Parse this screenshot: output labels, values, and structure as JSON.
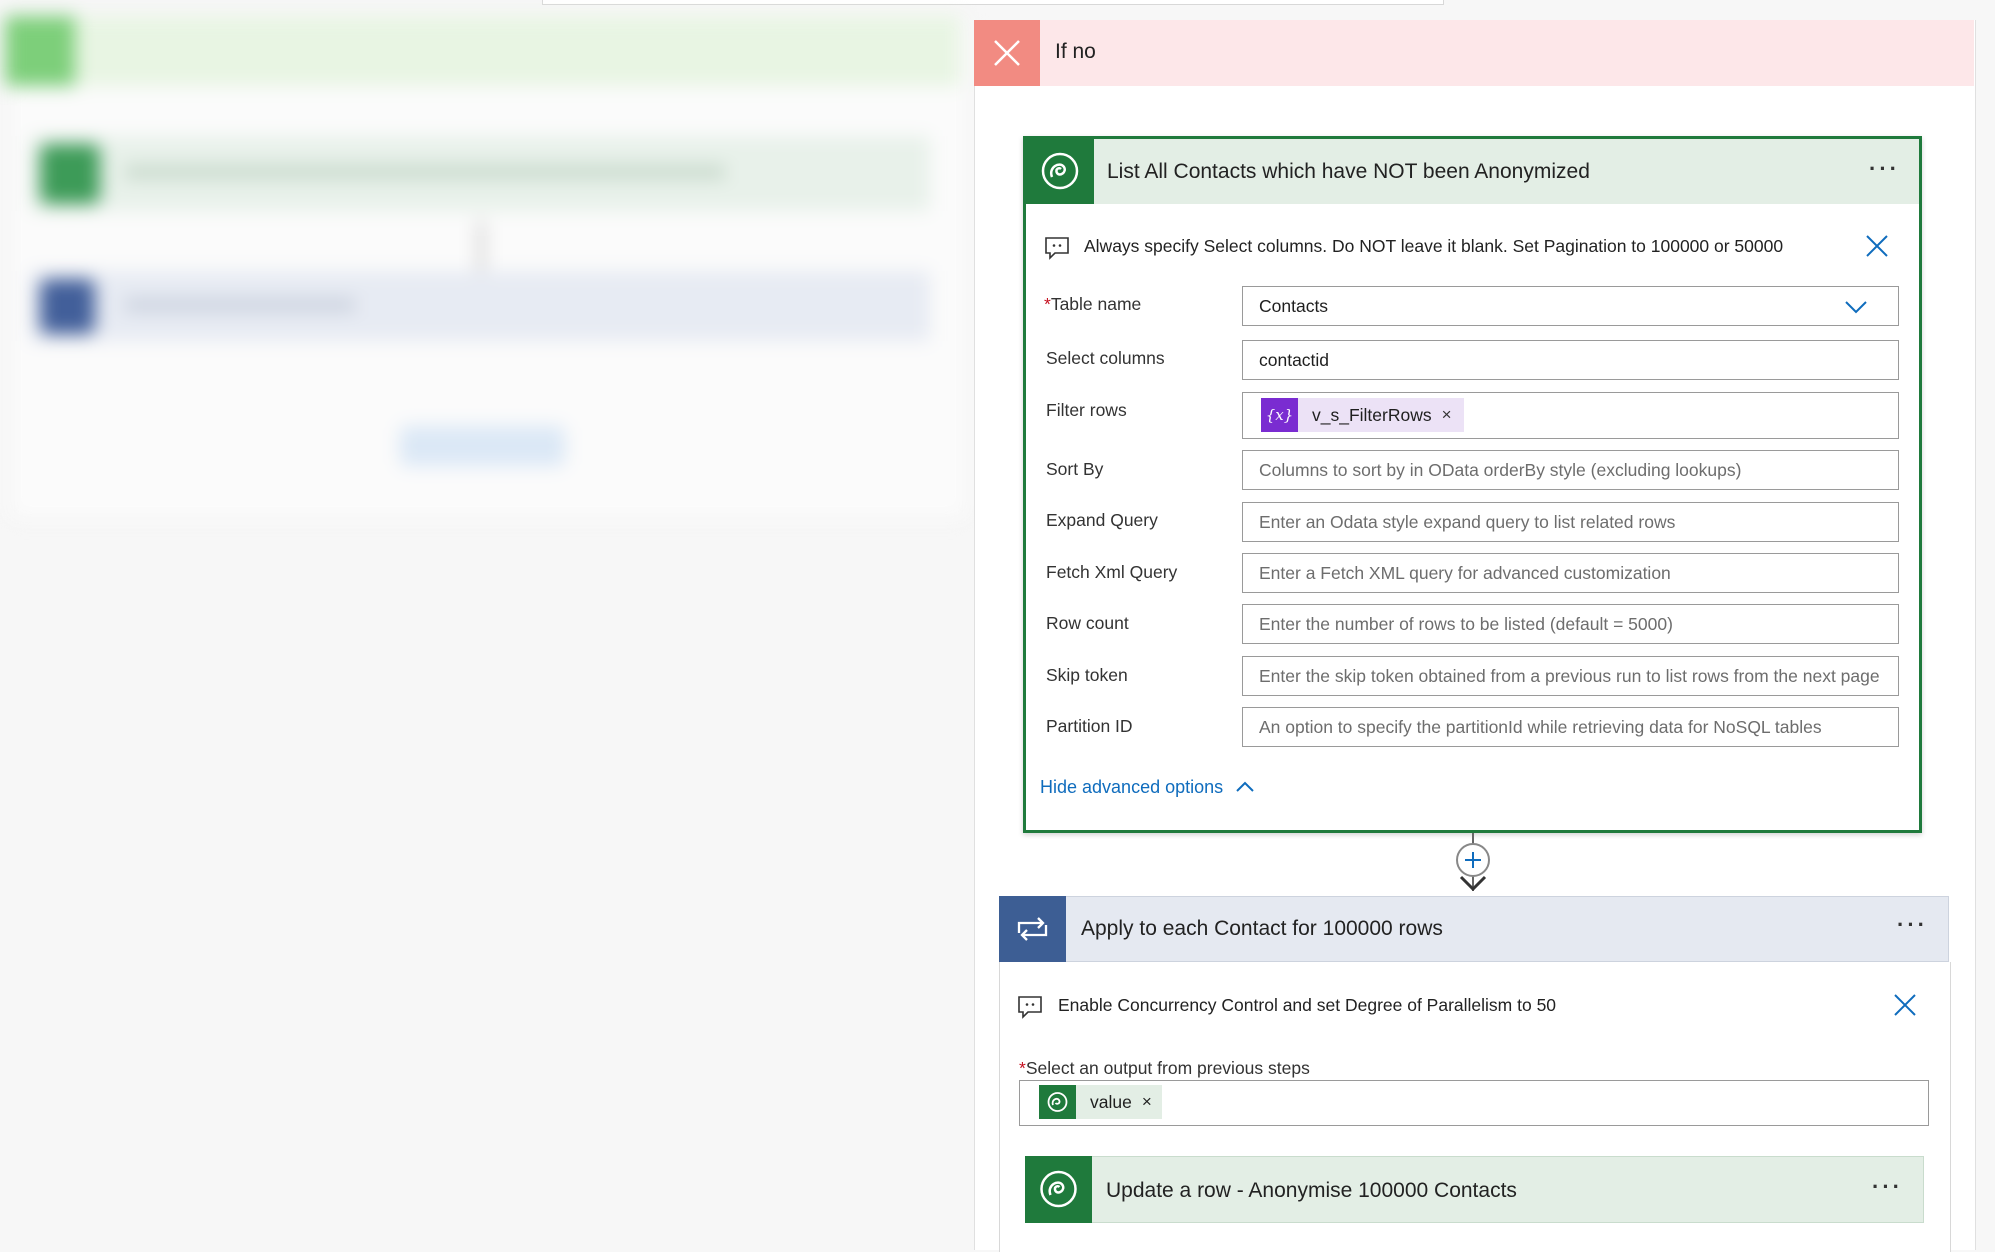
{
  "colors": {
    "if_no_header_bg": "#fde7e9",
    "if_no_icon_bg": "#f28b82",
    "dataverse_green": "#1f7a3c",
    "loop_blue": "#3d5e94",
    "link_blue": "#0f6cbd",
    "variable_purple": "#7a2cd1"
  },
  "if_no": {
    "title": "If no",
    "icon": "close-x-icon"
  },
  "list_contacts": {
    "title": "List All Contacts which have NOT been Anonymized",
    "icon": "dataverse-icon",
    "menu": "···",
    "comment": "Always specify Select columns. Do NOT leave it blank. Set Pagination to 100000 or 50000",
    "fields": {
      "table_name": {
        "label": "Table name",
        "required": "*",
        "value": "Contacts"
      },
      "select_columns": {
        "label": "Select columns",
        "value": "contactid"
      },
      "filter_rows": {
        "label": "Filter rows",
        "token": "v_s_FilterRows",
        "token_icon": "{x}",
        "token_remove": "×"
      },
      "sort_by": {
        "label": "Sort By",
        "placeholder": "Columns to sort by in OData orderBy style (excluding lookups)"
      },
      "expand_query": {
        "label": "Expand Query",
        "placeholder": "Enter an Odata style expand query to list related rows"
      },
      "fetch_xml": {
        "label": "Fetch Xml Query",
        "placeholder": "Enter a Fetch XML query for advanced customization"
      },
      "row_count": {
        "label": "Row count",
        "placeholder": "Enter the number of rows to be listed (default = 5000)"
      },
      "skip_token": {
        "label": "Skip token",
        "placeholder": "Enter the skip token obtained from a previous run to list rows from the next page"
      },
      "partition_id": {
        "label": "Partition ID",
        "placeholder": "An option to specify the partitionId while retrieving data for NoSQL tables"
      }
    },
    "hide_advanced": "Hide advanced options"
  },
  "apply_each": {
    "title": "Apply to each Contact for 100000 rows",
    "icon": "loop-icon",
    "menu": "···",
    "comment": "Enable Concurrency Control and set Degree of Parallelism to 50",
    "output_label": "Select an output from previous steps",
    "required": "*",
    "token": "value",
    "token_remove": "×"
  },
  "update_row": {
    "title": "Update a row - Anonymise 100000 Contacts",
    "icon": "dataverse-icon",
    "menu": "···"
  }
}
